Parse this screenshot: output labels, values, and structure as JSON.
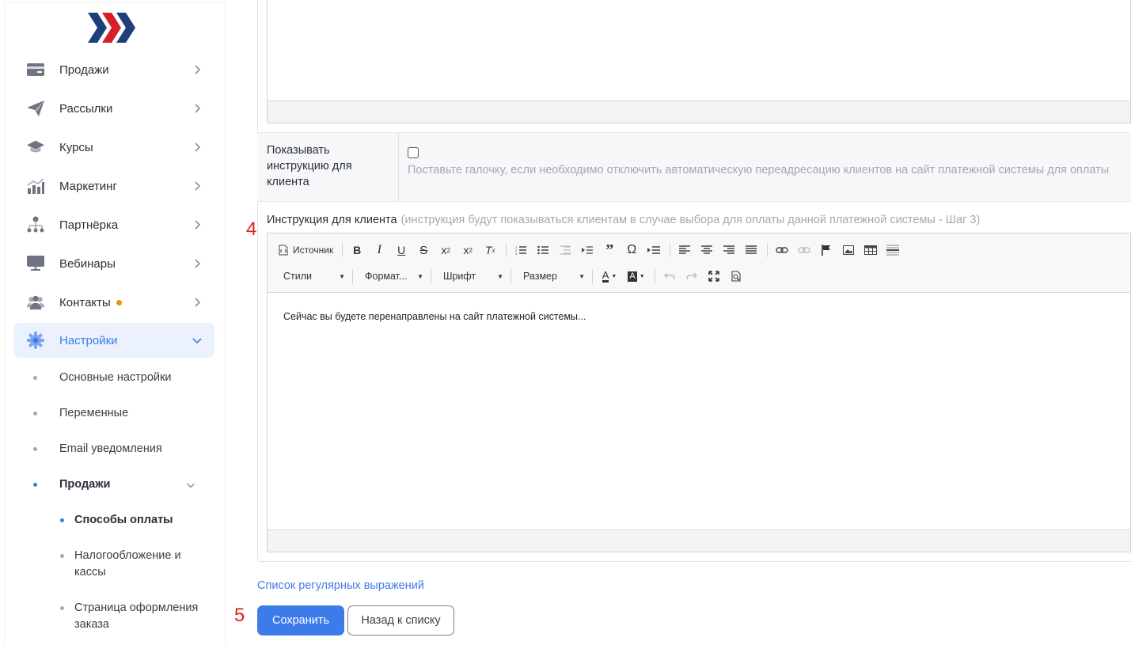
{
  "sidebar": {
    "logo": "logo-chevrons",
    "items": [
      {
        "label": "Продажи",
        "icon": "card-icon"
      },
      {
        "label": "Рассылки",
        "icon": "paper-plane-icon"
      },
      {
        "label": "Курсы",
        "icon": "graduation-cap-icon"
      },
      {
        "label": "Маркетинг",
        "icon": "chart-icon"
      },
      {
        "label": "Партнёрка",
        "icon": "network-icon"
      },
      {
        "label": "Вебинары",
        "icon": "monitor-icon"
      },
      {
        "label": "Контакты",
        "icon": "users-icon"
      },
      {
        "label": "Настройки",
        "icon": "gear-icon"
      }
    ],
    "settings_sub": [
      {
        "label": "Основные настройки"
      },
      {
        "label": "Переменные"
      },
      {
        "label": "Email уведомления"
      },
      {
        "label": "Продажи"
      }
    ],
    "sales_sub": [
      {
        "label": "Способы оплаты"
      },
      {
        "label": "Налогообложение и кассы"
      },
      {
        "label": "Страница оформления заказа"
      }
    ],
    "accent_color": "#3e7bea",
    "badge_color": "#e9960f"
  },
  "form": {
    "show_instruction_label": "Показывать инструкцию для клиента",
    "show_instruction_checked": false,
    "show_instruction_hint": "Поставьте галочку, если необходимо отключить автоматическую переадресацию клиентов на сайт платежной системы для оплаты",
    "instruction_title": "Инструкция для клиента",
    "instruction_hint": "(инструкция будут показываться клиентам в случае выбора для оплаты данной платежной системы - Шаг 3)",
    "step_marker_4": "4",
    "step_marker_5": "5"
  },
  "editor": {
    "source_label": "Источник",
    "combos": {
      "styles": "Стили",
      "format": "Формат...",
      "font": "Шрифт",
      "size": "Размер"
    },
    "content": "Сейчас вы будете перенаправлены на сайт платежной системы..."
  },
  "footer": {
    "regex_link": "Список регулярных выражений",
    "save_label": "Сохранить",
    "back_label": "Назад к списку"
  }
}
